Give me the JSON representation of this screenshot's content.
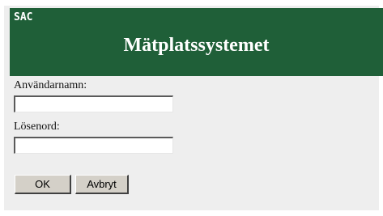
{
  "banner": {
    "logo": "SAC",
    "title": "Mätplatssystemet",
    "color": "#1f5f38"
  },
  "login": {
    "username_label": "Användarnamn:",
    "username_value": "",
    "password_label": "Lösenord:",
    "password_value": "",
    "ok_label": "OK",
    "cancel_label": "Avbryt"
  }
}
